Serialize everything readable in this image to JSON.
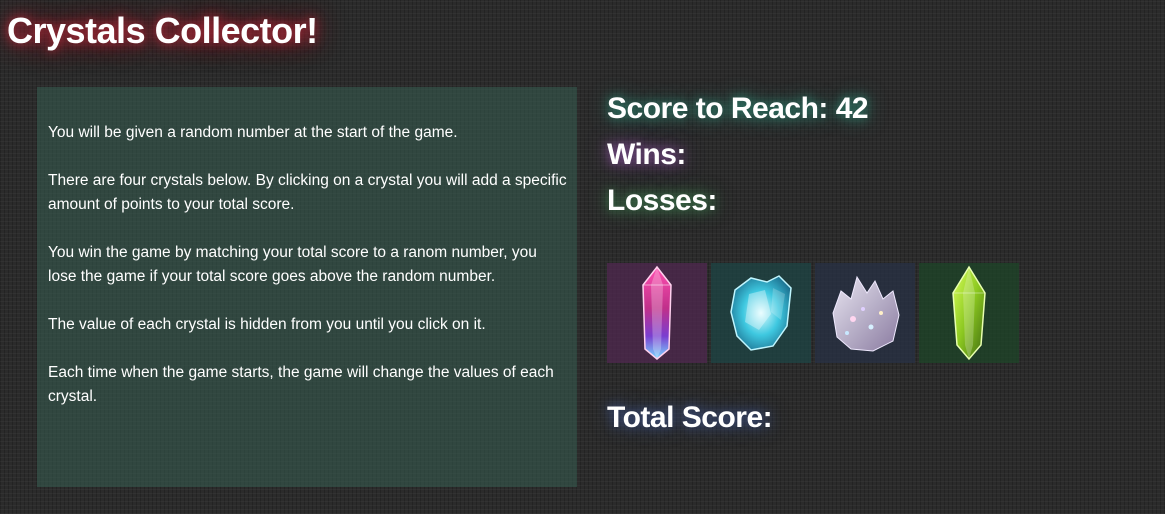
{
  "header": {
    "title": "Crystals Collector!"
  },
  "instructions": {
    "paragraphs": [
      "You will be given a random number at the start of the game.",
      "There are four crystals below. By clicking on a crystal you will add a specific amount of points to your total score.",
      "You win the game by matching your total score to a ranom number, you lose the game if your total score goes above the random number.",
      "The value of each crystal is hidden from you until you click on it.",
      "Each time when the game starts, the game will change the values of each crystal."
    ]
  },
  "stats": {
    "goal_label": "Score to Reach:",
    "goal_value": "42",
    "wins_label": "Wins:",
    "wins_value": "",
    "losses_label": "Losses:",
    "losses_value": ""
  },
  "crystals": [
    {
      "icon": "pink-crystal-icon",
      "color": "#c0308a"
    },
    {
      "icon": "blue-crystal-icon",
      "color": "#3ec8e0"
    },
    {
      "icon": "quartz-crystal-icon",
      "color": "#b8b0c8"
    },
    {
      "icon": "green-crystal-icon",
      "color": "#8cc820"
    }
  ],
  "total": {
    "label": "Total Score:",
    "value": ""
  }
}
